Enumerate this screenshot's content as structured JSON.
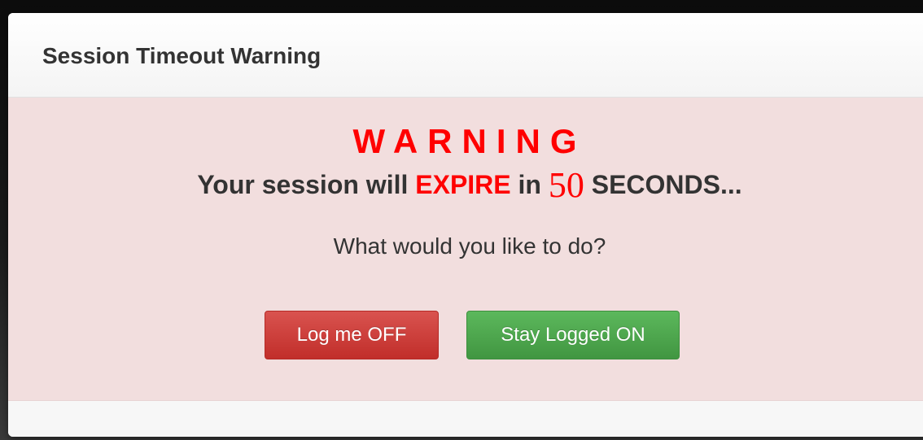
{
  "dialog": {
    "title": "Session Timeout Warning",
    "warning_heading": "WARNING",
    "message_prefix": "Your session will",
    "message_expire": "EXPIRE",
    "message_in": "in",
    "countdown_seconds": "50",
    "message_suffix": "SECONDS...",
    "question": "What would you like to do?"
  },
  "buttons": {
    "log_off_label": "Log me OFF",
    "stay_logged_on_label": "Stay Logged ON"
  },
  "colors": {
    "body_background": "#f2dede",
    "warning_red": "#ff0000",
    "danger_button": "#d9534f",
    "success_button": "#5cb85c",
    "text": "#333333"
  }
}
